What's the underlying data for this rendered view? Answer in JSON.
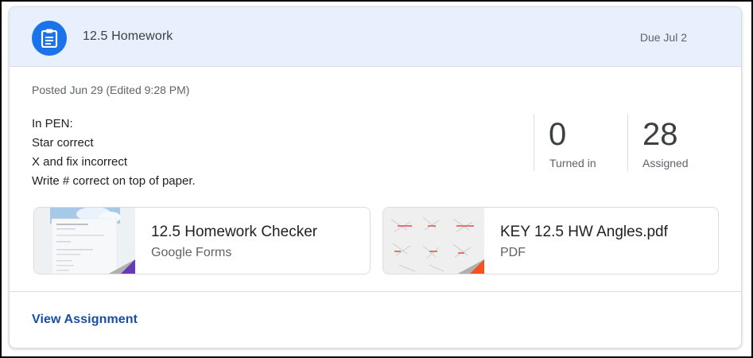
{
  "assignment": {
    "title": "12.5 Homework",
    "due": "Due Jul 2",
    "posted": "Posted Jun 29 (Edited 9:28 PM)",
    "instructions": [
      "In PEN:",
      "Star correct",
      "X and fix incorrect",
      "Write # correct on top of paper."
    ],
    "icon": "assignment-icon",
    "accent_color": "#1a73e8",
    "header_bg": "#e8f0fe"
  },
  "stats": {
    "turned_in": {
      "value": "0",
      "label": "Turned in"
    },
    "assigned": {
      "value": "28",
      "label": "Assigned"
    }
  },
  "attachments": [
    {
      "title": "12.5 Homework Checker",
      "type": "Google Forms",
      "badge_color": "#673ab7"
    },
    {
      "title": "KEY 12.5 HW Angles.pdf",
      "type": "PDF",
      "badge_color": "#f4511e"
    }
  ],
  "footer": {
    "view_link": "View Assignment"
  }
}
